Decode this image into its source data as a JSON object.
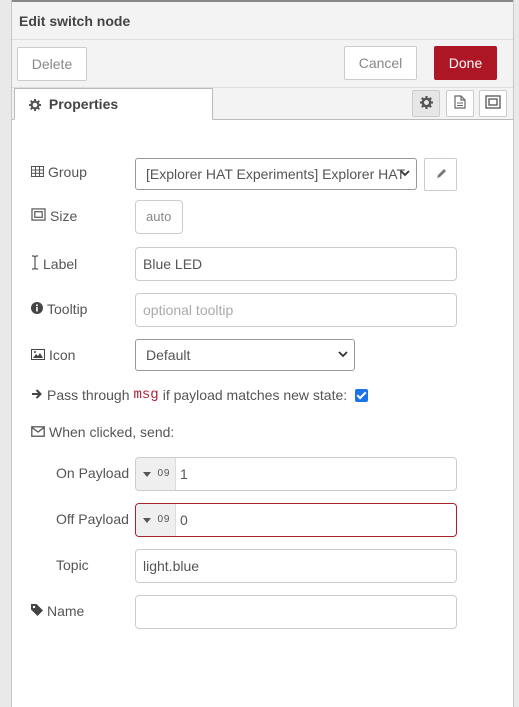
{
  "header": {
    "title": "Edit switch node"
  },
  "toolbar": {
    "delete": "Delete",
    "cancel": "Cancel",
    "done": "Done"
  },
  "tabs": {
    "properties": "Properties"
  },
  "icons": {
    "properties_tab": "gear-icon",
    "description_tab": "document-icon",
    "appearance_tab": "frame-icon",
    "group": "table-icon",
    "size": "frame-icon",
    "label": "text-cursor-icon",
    "tooltip": "info-circle-icon",
    "icon": "image-icon",
    "pass_through": "arrow-right-icon",
    "when_clicked": "envelope-icon",
    "name": "tag-icon",
    "edit": "pencil-icon",
    "type_dropdown": "caret-down-icon",
    "number_type": "number-icon"
  },
  "colors": {
    "primary_button": "#ad1625",
    "invalid_border": "#aa2222",
    "checkbox": "#1a73e8"
  },
  "form": {
    "group": {
      "label": "Group",
      "value": "[Explorer HAT Experiments] Explorer HAT"
    },
    "size": {
      "label": "Size",
      "value": "auto"
    },
    "label": {
      "label": "Label",
      "value": "Blue LED"
    },
    "tooltip": {
      "label": "Tooltip",
      "placeholder": "optional tooltip"
    },
    "icon": {
      "label": "Icon",
      "value": "Default"
    },
    "pass_through": {
      "prefix": "Pass through",
      "code": "msg",
      "suffix": "if payload matches new state:",
      "checked": true
    },
    "when_clicked": {
      "label": "When clicked, send:"
    },
    "on_payload": {
      "label": "On Payload",
      "type_glyph": "0 9",
      "value": "1"
    },
    "off_payload": {
      "label": "Off Payload",
      "type_glyph": "0 9",
      "value": "0"
    },
    "topic": {
      "label": "Topic",
      "value": "light.blue"
    },
    "name": {
      "label": "Name",
      "value": ""
    }
  }
}
